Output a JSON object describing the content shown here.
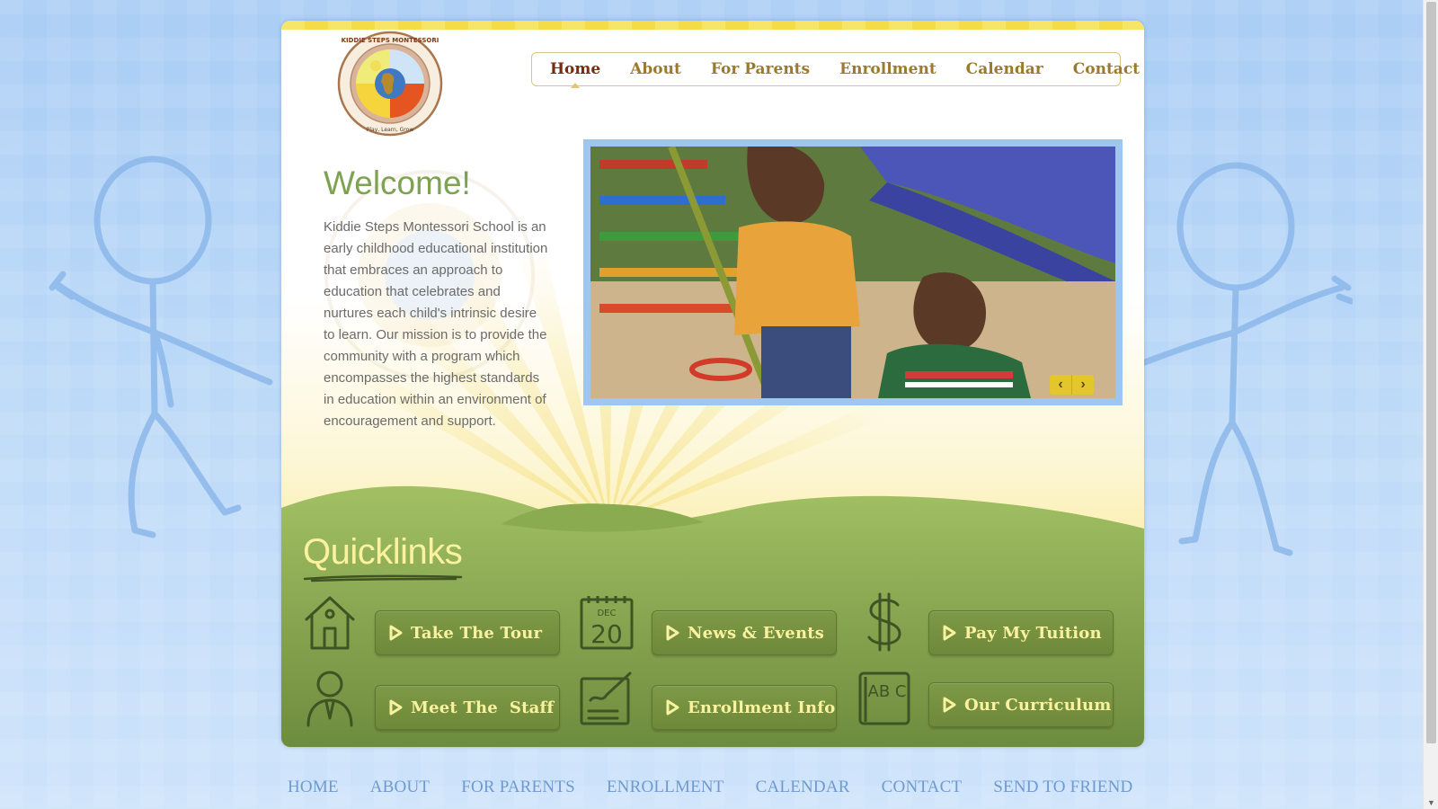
{
  "logo": {
    "arc_text": "KIDDIE STEPS MONTESSORI",
    "tagline": "Play, Learn, Grow"
  },
  "nav": {
    "items": [
      {
        "label": "Home",
        "active": true
      },
      {
        "label": "About",
        "active": false
      },
      {
        "label": "For Parents",
        "active": false
      },
      {
        "label": "Enrollment",
        "active": false
      },
      {
        "label": "Calendar",
        "active": false
      },
      {
        "label": "Contact",
        "active": false
      }
    ]
  },
  "welcome": {
    "title": "Welcome!",
    "body": "Kiddie Steps Montessori School is an early childhood educational institution that embraces an approach to education that celebrates and nurtures each child's intrinsic desire to learn. Our mission is to provide the community with a program which encompasses the highest standards in education within an environment of encouragement and support."
  },
  "slider": {
    "prev_symbol": "‹",
    "next_symbol": "›"
  },
  "quicklinks": {
    "title": "Quicklinks",
    "items": [
      {
        "label": "Take The Tour",
        "icon": "house-icon"
      },
      {
        "label": "News & Events",
        "icon": "calendar-icon",
        "icon_text_month": "DEC",
        "icon_text_day": "20"
      },
      {
        "label": "Pay My Tuition",
        "icon": "dollar-icon"
      },
      {
        "label": "Meet The  Staff",
        "icon": "person-icon"
      },
      {
        "label": "Enrollment Info",
        "icon": "enrollment-form-icon"
      },
      {
        "label": "Our Curriculum",
        "icon": "abc-block-icon",
        "icon_text": "AB C"
      }
    ]
  },
  "footer": {
    "links": [
      "HOME",
      "ABOUT",
      "FOR PARENTS",
      "ENROLLMENT",
      "CALENDAR",
      "CONTACT",
      "SEND TO FRIEND"
    ]
  },
  "colors": {
    "background": "#bcd9f8",
    "nav_text": "#9b7a2c",
    "nav_active": "#7a2a0f",
    "welcome_title": "#7da350",
    "hill_green": "#8aab4f",
    "button_green": "#7e9a48",
    "button_text": "#fbf2a0",
    "footer_link": "#6f9ad0"
  }
}
